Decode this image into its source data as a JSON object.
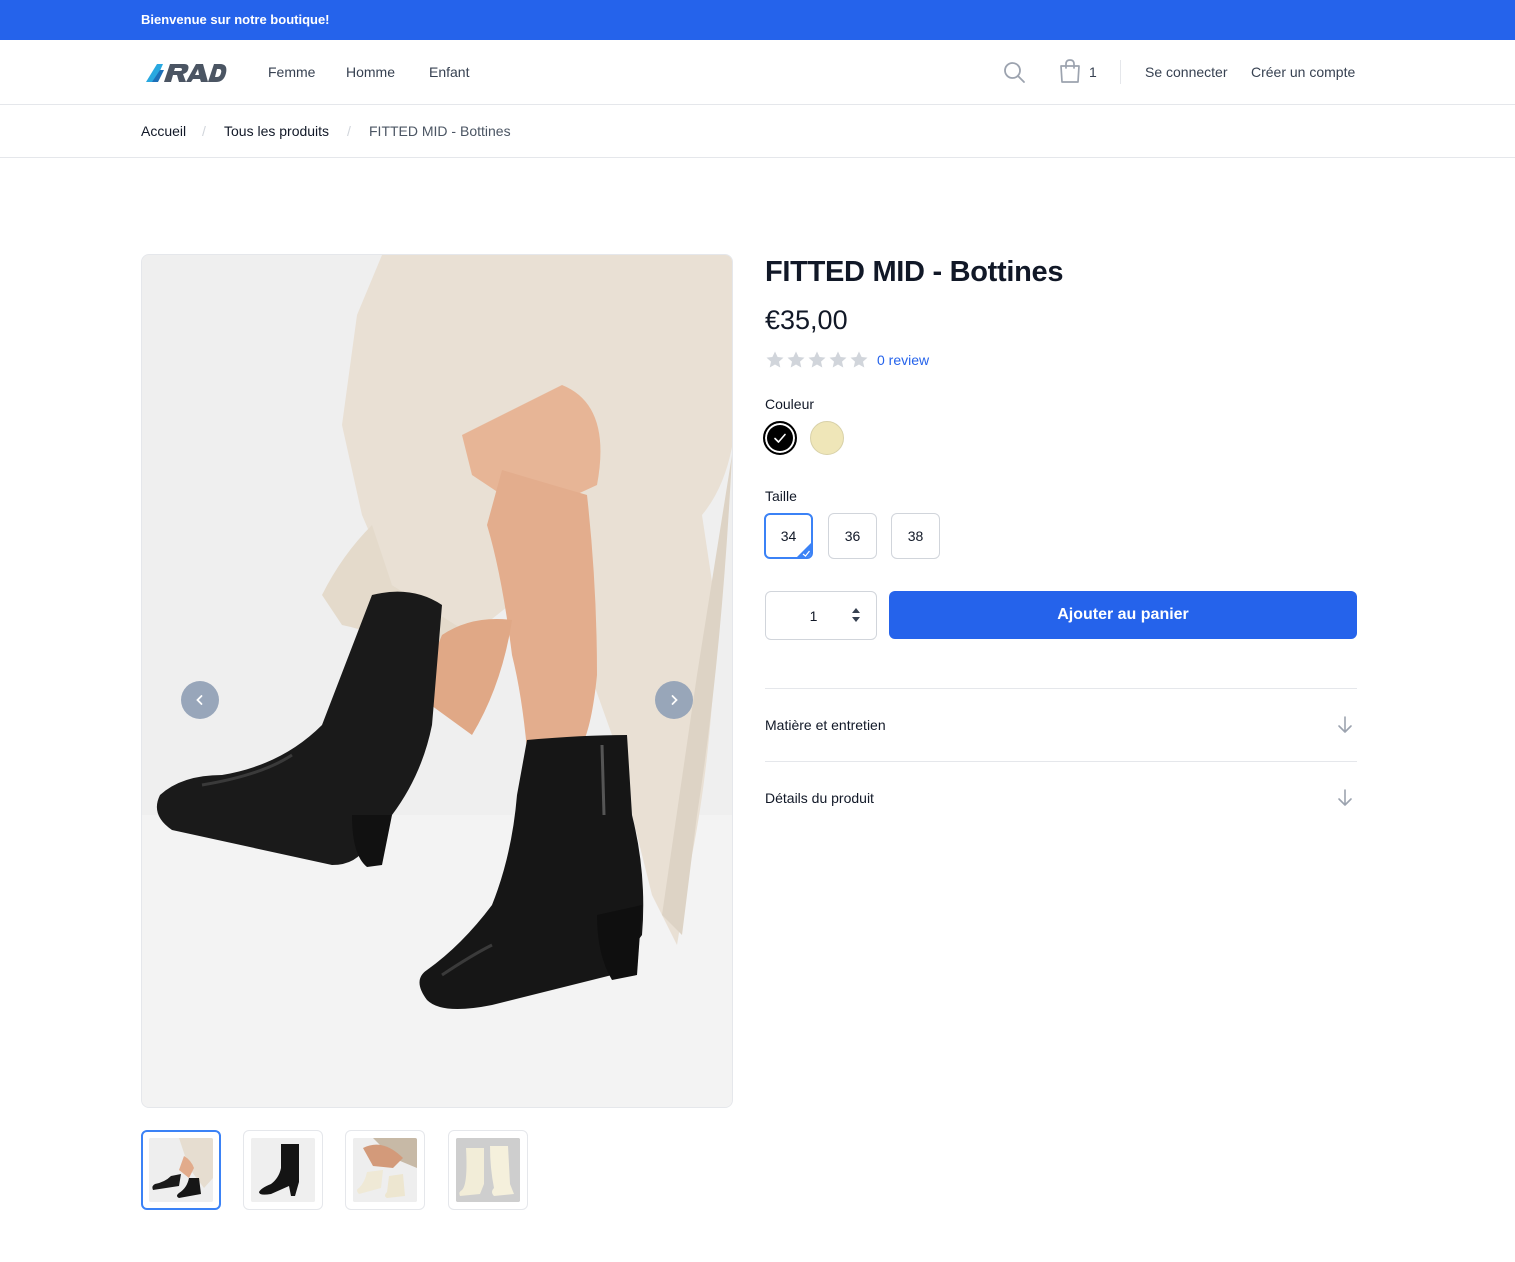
{
  "announcement": "Bienvenue sur notre boutique!",
  "header": {
    "logo_text": "RAD",
    "nav": [
      "Femme",
      "Homme",
      "Enfant"
    ],
    "cart_count": "1",
    "login": "Se connecter",
    "signup": "Créer un compte"
  },
  "breadcrumb": {
    "home": "Accueil",
    "all": "Tous les produits",
    "current": "FITTED MID - Bottines",
    "separator": "/"
  },
  "product": {
    "title": "FITTED MID - Bottines",
    "price": "€35,00",
    "rating": 0,
    "rating_max": 5,
    "review_text": "0 review",
    "color_label": "Couleur",
    "colors": [
      {
        "name": "black",
        "hex": "#000000",
        "selected": true
      },
      {
        "name": "cream",
        "hex": "#efe6b8",
        "selected": false
      }
    ],
    "size_label": "Taille",
    "sizes": [
      "34",
      "36",
      "38"
    ],
    "selected_size": "34",
    "quantity": "1",
    "add_to_cart": "Ajouter au panier",
    "accordion": [
      "Matière et entretien",
      "Détails du produit"
    ]
  },
  "gallery": {
    "thumbnail_count": 4,
    "active_thumbnail": 0
  },
  "colors": {
    "accent": "#2563eb",
    "text": "#111827",
    "border": "#e5e7eb"
  }
}
